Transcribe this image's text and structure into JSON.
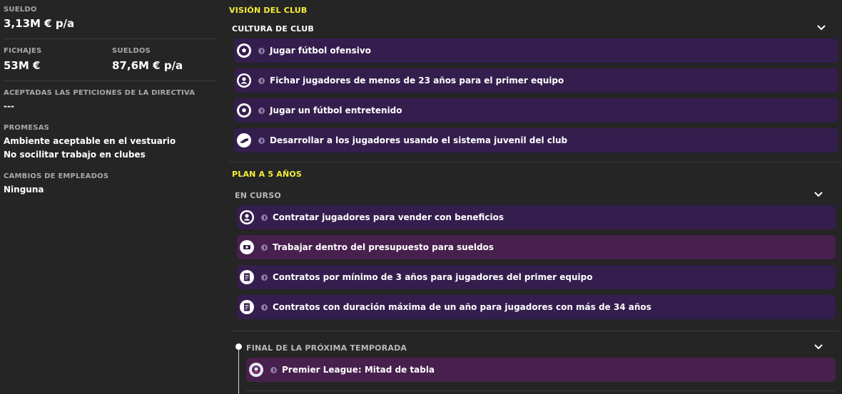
{
  "left": {
    "salary": {
      "label": "SUELDO",
      "value": "3,13M € p/a"
    },
    "transfers": {
      "label": "FICHAJES",
      "value": "53M €"
    },
    "wages": {
      "label": "SUELDOS",
      "value": "87,6M € p/a"
    },
    "board_requests": {
      "label": "ACEPTADAS LAS PETICIONES DE LA DIRECTIVA",
      "value": "---"
    },
    "promises": {
      "label": "PROMESAS",
      "items": [
        "Ambiente aceptable en el vestuario",
        "No socilitar trabajo en clubes"
      ]
    },
    "staff_changes": {
      "label": "CAMBIOS DE EMPLEADOS",
      "value": "Ninguna"
    }
  },
  "vision": {
    "title": "VISIÓN DEL CLUB",
    "culture": {
      "title": "CULTURA DE CLUB",
      "items": [
        {
          "text": "Jugar fútbol ofensivo",
          "icon": "football-icon"
        },
        {
          "text": "Fichar jugadores de menos de 23 años para el primer equipo",
          "icon": "player-icon"
        },
        {
          "text": "Jugar un fútbol entretenido",
          "icon": "football-icon"
        },
        {
          "text": "Desarrollar a los jugadores usando el sistema juvenil del club",
          "icon": "boot-icon"
        }
      ]
    }
  },
  "plan": {
    "title": "PLAN A 5 AÑOS",
    "ongoing": {
      "title": "EN CURSO",
      "items": [
        {
          "text": "Contratar jugadores para vender con beneficios",
          "icon": "player-icon"
        },
        {
          "text": "Trabajar dentro del presupuesto para sueldos",
          "icon": "money-icon"
        },
        {
          "text": "Contratos por mínimo de 3 años para jugadores del primer equipo",
          "icon": "contract-icon"
        },
        {
          "text": "Contratos con duración máxima de un año para jugadores con más de 34 años",
          "icon": "contract-icon"
        }
      ]
    },
    "next_season": {
      "title": "FINAL DE LA PRÓXIMA TEMPORADA",
      "items": [
        {
          "text": "Premier League: Mitad de tabla",
          "icon": "league-logo-icon"
        }
      ]
    }
  },
  "colors": {
    "background": "#252525",
    "accent_yellow": "#f5ef3a",
    "item_purple": "#341e4d",
    "item_purple_highlight": "#47204d"
  }
}
